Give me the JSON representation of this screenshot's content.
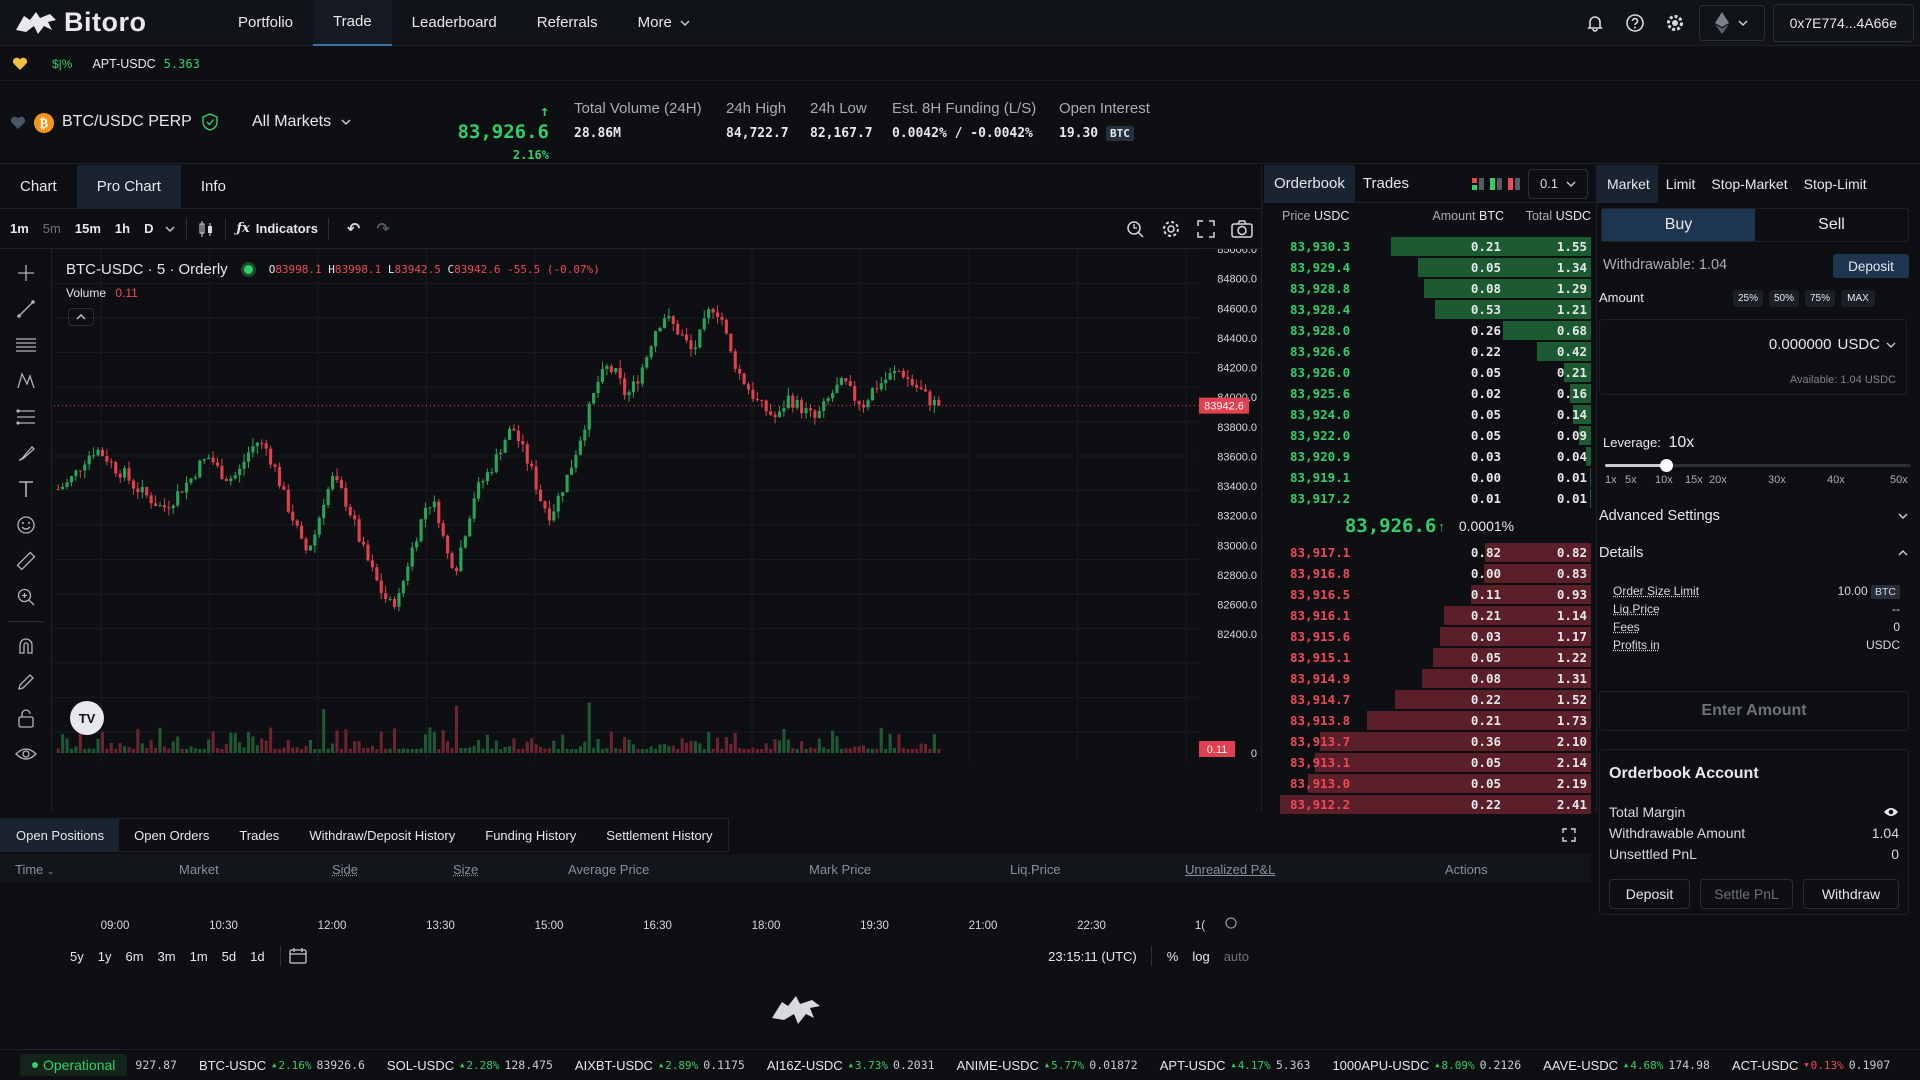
{
  "nav": {
    "brand": "Bitoro",
    "links": [
      "Portfolio",
      "Trade",
      "Leaderboard",
      "Referrals",
      "More"
    ],
    "wallet": "0x7E774...4A66e"
  },
  "watch": {
    "toggle": "$|%",
    "symbol": "APT-USDC",
    "price": "5.363"
  },
  "market": {
    "pair": "BTC/USDC PERP",
    "selector": "All Markets",
    "price": "83,926.6",
    "change": "2.16%",
    "stats": [
      {
        "label": "Total Volume (24H)",
        "value": "28.86M"
      },
      {
        "label": "24h High",
        "value": "84,722.7"
      },
      {
        "label": "24h Low",
        "value": "82,167.7"
      },
      {
        "label": "Est. 8H Funding (L/S)",
        "value": "0.0042% / -0.0042%"
      },
      {
        "label": "Open Interest",
        "value": "19.30",
        "unit": "BTC"
      }
    ]
  },
  "chart": {
    "tabs": [
      "Chart",
      "Pro Chart",
      "Info"
    ],
    "timeframes": [
      "1m",
      "5m",
      "15m",
      "1h",
      "D"
    ],
    "indicators_label": "Indicators",
    "legend_title": "BTC-USDC · 5 · Orderly",
    "ohlc": {
      "o": "83998.1",
      "h": "83998.1",
      "l": "83942.5",
      "c": "83942.6",
      "chg": "-55.5 (-0.07%)"
    },
    "volume_label": "Volume",
    "volume_value": "0.11",
    "last_price_tag": "83942.6",
    "volume_tag": "0.11",
    "time_display": "23:15:11 (UTC)",
    "ranges": [
      "5y",
      "1y",
      "6m",
      "3m",
      "1m",
      "5d",
      "1d"
    ],
    "scale_opts": [
      "%",
      "log",
      "auto"
    ]
  },
  "chart_data": {
    "type": "candlestick",
    "title": "BTC-USDC · 5 · Orderly",
    "x_ticks": [
      "09:00",
      "10:30",
      "12:00",
      "13:30",
      "15:00",
      "16:30",
      "18:00",
      "19:30",
      "21:00",
      "22:30",
      "1("
    ],
    "y_ticks": [
      "85000.0",
      "84800.0",
      "84600.0",
      "84400.0",
      "84200.0",
      "84000.0",
      "83800.0",
      "83600.0",
      "83400.0",
      "83200.0",
      "83000.0",
      "82800.0",
      "82600.0",
      "82400.0",
      "0"
    ],
    "ylim": [
      82300,
      85000
    ],
    "close_path": [
      83380,
      83420,
      83500,
      83600,
      83650,
      83600,
      83520,
      83480,
      83400,
      83350,
      83300,
      83250,
      83300,
      83380,
      83450,
      83550,
      83600,
      83500,
      83450,
      83480,
      83620,
      83700,
      83650,
      83500,
      83300,
      83150,
      82950,
      83050,
      83300,
      83450,
      83350,
      83200,
      83000,
      82850,
      82700,
      82600,
      82650,
      82900,
      83100,
      83300,
      83250,
      82950,
      82850,
      83100,
      83350,
      83450,
      83550,
      83700,
      83800,
      83650,
      83500,
      83300,
      83200,
      83350,
      83500,
      83700,
      83900,
      84100,
      84200,
      84150,
      84000,
      84100,
      84250,
      84450,
      84550,
      84480,
      84400,
      84300,
      84450,
      84620,
      84550,
      84300,
      84150,
      84050,
      83950,
      83900,
      83850,
      84000,
      83950,
      83900,
      83850,
      83950,
      84050,
      84100,
      84000,
      83950,
      84050,
      84100,
      84150,
      84180,
      84100,
      84050,
      83980,
      83942.6
    ],
    "last": 83942.6
  },
  "orderbook": {
    "tabs": [
      "Orderbook",
      "Trades"
    ],
    "precision": "0.1",
    "headers": [
      "Price",
      "USDC",
      "Amount",
      "BTC",
      "Total",
      "USDC"
    ],
    "asks": [
      [
        "83,930.3",
        "0.21",
        "1.55",
        1.55
      ],
      [
        "83,929.4",
        "0.05",
        "1.34",
        1.34
      ],
      [
        "83,928.8",
        "0.08",
        "1.29",
        1.29
      ],
      [
        "83,928.4",
        "0.53",
        "1.21",
        1.21
      ],
      [
        "83,928.0",
        "0.26",
        "0.68",
        0.68
      ],
      [
        "83,926.6",
        "0.22",
        "0.42",
        0.42
      ],
      [
        "83,926.0",
        "0.05",
        "0.21",
        0.21
      ],
      [
        "83,925.6",
        "0.02",
        "0.16",
        0.16
      ],
      [
        "83,924.0",
        "0.05",
        "0.14",
        0.14
      ],
      [
        "83,922.0",
        "0.05",
        "0.09",
        0.09
      ],
      [
        "83,920.9",
        "0.03",
        "0.04",
        0.04
      ],
      [
        "83,919.1",
        "0.00",
        "0.01",
        0.01
      ],
      [
        "83,917.2",
        "0.01",
        "0.01",
        0.01
      ]
    ],
    "mid_price": "83,926.6",
    "mid_spread": "0.0001%",
    "bids": [
      [
        "83,917.1",
        "0.82",
        "0.82",
        0.82
      ],
      [
        "83,916.8",
        "0.00",
        "0.83",
        0.83
      ],
      [
        "83,916.5",
        "0.11",
        "0.93",
        0.93
      ],
      [
        "83,916.1",
        "0.21",
        "1.14",
        1.14
      ],
      [
        "83,915.6",
        "0.03",
        "1.17",
        1.17
      ],
      [
        "83,915.1",
        "0.05",
        "1.22",
        1.22
      ],
      [
        "83,914.9",
        "0.08",
        "1.31",
        1.31
      ],
      [
        "83,914.7",
        "0.22",
        "1.52",
        1.52
      ],
      [
        "83,913.8",
        "0.21",
        "1.73",
        1.73
      ],
      [
        "83,913.7",
        "0.36",
        "2.10",
        2.1
      ],
      [
        "83,913.1",
        "0.05",
        "2.14",
        2.14
      ],
      [
        "83,913.0",
        "0.05",
        "2.19",
        2.19
      ],
      [
        "83,912.2",
        "0.22",
        "2.41",
        2.41
      ]
    ]
  },
  "order": {
    "types": [
      "Market",
      "Limit",
      "Stop-Market",
      "Stop-Limit"
    ],
    "buy": "Buy",
    "sell": "Sell",
    "withdrawable": "Withdrawable: 1.04",
    "deposit": "Deposit",
    "amount_label": "Amount",
    "pct": [
      "25%",
      "50%",
      "75%",
      "MAX"
    ],
    "amount_value": "0.000000",
    "amount_unit": "USDC",
    "available": "Available: 1.04 USDC",
    "leverage_label": "Leverage:",
    "leverage_value": "10x",
    "leverage_fraction": 0.2,
    "leverage_marks": [
      "1x",
      "5x",
      "10x",
      "15x",
      "20x",
      "30x",
      "40x",
      "50x"
    ],
    "advanced": "Advanced Settings",
    "details": "Details",
    "detail_rows": [
      {
        "label": "Order Size Limit",
        "value": "10.00",
        "unit": "BTC"
      },
      {
        "label": "Liq.Price",
        "value": "--",
        "unit": ""
      },
      {
        "label": "Fees",
        "value": "0",
        "unit": ""
      },
      {
        "label": "Profits in",
        "value": "USDC",
        "unit": ""
      }
    ],
    "enter_amount": "Enter Amount",
    "account_title": "Orderbook Account",
    "account_rows": [
      {
        "label": "Total Margin",
        "value": ""
      },
      {
        "label": "Withdrawable Amount",
        "value": "1.04"
      },
      {
        "label": "Unsettled PnL",
        "value": "0"
      }
    ],
    "account_buttons": [
      "Deposit",
      "Settle PnL",
      "Withdraw"
    ]
  },
  "positions": {
    "tabs": [
      "Open Positions",
      "Open Orders",
      "Trades",
      "Withdraw/Deposit History",
      "Funding History",
      "Settlement History"
    ],
    "columns": [
      "Time",
      "Market",
      "Side",
      "Size",
      "Average Price",
      "Mark Price",
      "Liq.Price",
      "Unrealized P&L",
      "Actions"
    ]
  },
  "footer": {
    "status": "Operational",
    "first_price": "927.87",
    "tickers": [
      {
        "sym": "BTC-USDC",
        "chg": "2.16%",
        "px": "83926.6",
        "up": true
      },
      {
        "sym": "SOL-USDC",
        "chg": "2.28%",
        "px": "128.475",
        "up": true
      },
      {
        "sym": "AIXBT-USDC",
        "chg": "2.89%",
        "px": "0.1175",
        "up": true
      },
      {
        "sym": "AI16Z-USDC",
        "chg": "3.73%",
        "px": "0.2031",
        "up": true
      },
      {
        "sym": "ANIME-USDC",
        "chg": "5.77%",
        "px": "0.01872",
        "up": true
      },
      {
        "sym": "APT-USDC",
        "chg": "4.17%",
        "px": "5.363",
        "up": true
      },
      {
        "sym": "1000APU-USDC",
        "chg": "8.09%",
        "px": "0.2126",
        "up": true
      },
      {
        "sym": "AAVE-USDC",
        "chg": "4.68%",
        "px": "174.98",
        "up": true
      },
      {
        "sym": "ACT-USDC",
        "chg": "0.13%",
        "px": "0.1907",
        "up": false
      }
    ]
  },
  "colors": {
    "up": "#2fcf6a",
    "down": "#f0485a",
    "accent": "#3a6ea5",
    "bg": "#0d0f12"
  }
}
